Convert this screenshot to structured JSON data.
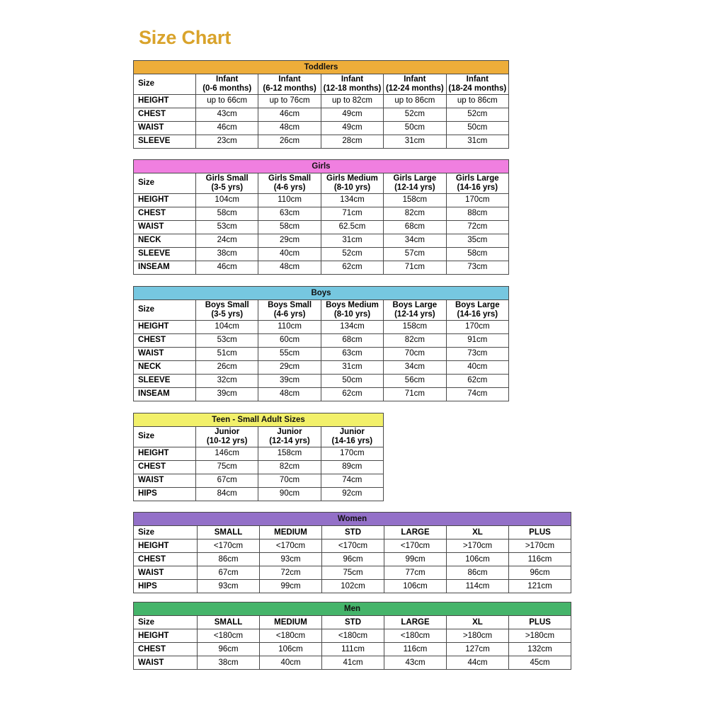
{
  "title": "Size Chart",
  "title_color": "#D9A32B",
  "page_background": "#FFFFFF",
  "tables": [
    {
      "name": "Toddlers",
      "banner_color": "#EDAD3A",
      "left_label": "Size",
      "columns": [
        {
          "name": "Infant",
          "sub": "(0-6 months)"
        },
        {
          "name": "Infant",
          "sub": "(6-12 months)"
        },
        {
          "name": "Infant",
          "sub": "(12-18 months)"
        },
        {
          "name": "Infant",
          "sub": "(12-24 months)"
        },
        {
          "name": "Infant",
          "sub": "(18-24 months)"
        }
      ],
      "rows": [
        {
          "label": "HEIGHT",
          "values": [
            "up to 66cm",
            "up to 76cm",
            "up to 82cm",
            "up to 86cm",
            "up to 86cm"
          ]
        },
        {
          "label": "CHEST",
          "values": [
            "43cm",
            "46cm",
            "49cm",
            "52cm",
            "52cm"
          ]
        },
        {
          "label": "WAIST",
          "values": [
            "46cm",
            "48cm",
            "49cm",
            "50cm",
            "50cm"
          ]
        },
        {
          "label": "SLEEVE",
          "values": [
            "23cm",
            "26cm",
            "28cm",
            "31cm",
            "31cm"
          ]
        }
      ]
    },
    {
      "name": "Girls",
      "banner_color": "#F07FE0",
      "left_label": "Size",
      "columns": [
        {
          "name": "Girls Small",
          "sub": "(3-5 yrs)"
        },
        {
          "name": "Girls Small",
          "sub": "(4-6 yrs)"
        },
        {
          "name": "Girls Medium",
          "sub": "(8-10 yrs)"
        },
        {
          "name": "Girls Large",
          "sub": "(12-14 yrs)"
        },
        {
          "name": "Girls Large",
          "sub": "(14-16 yrs)"
        }
      ],
      "rows": [
        {
          "label": "HEIGHT",
          "values": [
            "104cm",
            "110cm",
            "134cm",
            "158cm",
            "170cm"
          ]
        },
        {
          "label": "CHEST",
          "values": [
            "58cm",
            "63cm",
            "71cm",
            "82cm",
            "88cm"
          ]
        },
        {
          "label": "WAIST",
          "values": [
            "53cm",
            "58cm",
            "62.5cm",
            "68cm",
            "72cm"
          ]
        },
        {
          "label": "NECK",
          "values": [
            "24cm",
            "29cm",
            "31cm",
            "34cm",
            "35cm"
          ]
        },
        {
          "label": "SLEEVE",
          "values": [
            "38cm",
            "40cm",
            "52cm",
            "57cm",
            "58cm"
          ]
        },
        {
          "label": "INSEAM",
          "values": [
            "46cm",
            "48cm",
            "62cm",
            "71cm",
            "73cm"
          ]
        }
      ]
    },
    {
      "name": "Boys",
      "banner_color": "#76C7E0",
      "left_label": "Size",
      "columns": [
        {
          "name": "Boys Small",
          "sub": "(3-5 yrs)"
        },
        {
          "name": "Boys Small",
          "sub": "(4-6 yrs)"
        },
        {
          "name": "Boys Medium",
          "sub": "(8-10 yrs)"
        },
        {
          "name": "Boys Large",
          "sub": "(12-14 yrs)"
        },
        {
          "name": "Boys Large",
          "sub": "(14-16 yrs)"
        }
      ],
      "rows": [
        {
          "label": "HEIGHT",
          "values": [
            "104cm",
            "110cm",
            "134cm",
            "158cm",
            "170cm"
          ]
        },
        {
          "label": "CHEST",
          "values": [
            "53cm",
            "60cm",
            "68cm",
            "82cm",
            "91cm"
          ]
        },
        {
          "label": "WAIST",
          "values": [
            "51cm",
            "55cm",
            "63cm",
            "70cm",
            "73cm"
          ]
        },
        {
          "label": "NECK",
          "values": [
            "26cm",
            "29cm",
            "31cm",
            "34cm",
            "40cm"
          ]
        },
        {
          "label": "SLEEVE",
          "values": [
            "32cm",
            "39cm",
            "50cm",
            "56cm",
            "62cm"
          ]
        },
        {
          "label": "INSEAM",
          "values": [
            "39cm",
            "48cm",
            "62cm",
            "71cm",
            "74cm"
          ]
        }
      ]
    },
    {
      "name": "Teen - Small Adult Sizes",
      "banner_color": "#F2F06A",
      "left_label": "Size",
      "columns": [
        {
          "name": "Junior",
          "sub": "(10-12 yrs)"
        },
        {
          "name": "Junior",
          "sub": "(12-14 yrs)"
        },
        {
          "name": "Junior",
          "sub": "(14-16 yrs)"
        }
      ],
      "rows": [
        {
          "label": "HEIGHT",
          "values": [
            "146cm",
            "158cm",
            "170cm"
          ]
        },
        {
          "label": "CHEST",
          "values": [
            "75cm",
            "82cm",
            "89cm"
          ]
        },
        {
          "label": "WAIST",
          "values": [
            "67cm",
            "70cm",
            "74cm"
          ]
        },
        {
          "label": "HIPS",
          "values": [
            "84cm",
            "90cm",
            "92cm"
          ]
        }
      ]
    },
    {
      "name": "Women",
      "banner_color": "#9370C8",
      "left_label": "Size",
      "columns": [
        {
          "name": "SMALL",
          "sub": ""
        },
        {
          "name": "MEDIUM",
          "sub": ""
        },
        {
          "name": "STD",
          "sub": ""
        },
        {
          "name": "LARGE",
          "sub": ""
        },
        {
          "name": "XL",
          "sub": ""
        },
        {
          "name": "PLUS",
          "sub": ""
        }
      ],
      "rows": [
        {
          "label": "HEIGHT",
          "values": [
            "<170cm",
            "<170cm",
            "<170cm",
            "<170cm",
            ">170cm",
            ">170cm"
          ]
        },
        {
          "label": "CHEST",
          "values": [
            "86cm",
            "93cm",
            "96cm",
            "99cm",
            "106cm",
            "116cm"
          ]
        },
        {
          "label": "WAIST",
          "values": [
            "67cm",
            "72cm",
            "75cm",
            "77cm",
            "86cm",
            "96cm"
          ]
        },
        {
          "label": "HIPS",
          "values": [
            "93cm",
            "99cm",
            "102cm",
            "106cm",
            "114cm",
            "121cm"
          ]
        }
      ]
    },
    {
      "name": "Men",
      "banner_color": "#45B46A",
      "left_label": "Size",
      "columns": [
        {
          "name": "SMALL",
          "sub": ""
        },
        {
          "name": "MEDIUM",
          "sub": ""
        },
        {
          "name": "STD",
          "sub": ""
        },
        {
          "name": "LARGE",
          "sub": ""
        },
        {
          "name": "XL",
          "sub": ""
        },
        {
          "name": "PLUS",
          "sub": ""
        }
      ],
      "rows": [
        {
          "label": "HEIGHT",
          "values": [
            "<180cm",
            "<180cm",
            "<180cm",
            "<180cm",
            ">180cm",
            ">180cm"
          ]
        },
        {
          "label": "CHEST",
          "values": [
            "96cm",
            "106cm",
            "111cm",
            "116cm",
            "127cm",
            "132cm"
          ]
        },
        {
          "label": "WAIST",
          "values": [
            "38cm",
            "40cm",
            "41cm",
            "43cm",
            "44cm",
            "45cm"
          ]
        }
      ]
    }
  ],
  "layout": {
    "table_tops": [
      85,
      225,
      404,
      583,
      723,
      850
    ],
    "table_widths": [
      530,
      530,
      530,
      353,
      618,
      618
    ],
    "label_col_widths": [
      88,
      88,
      88,
      88,
      90,
      90
    ]
  }
}
